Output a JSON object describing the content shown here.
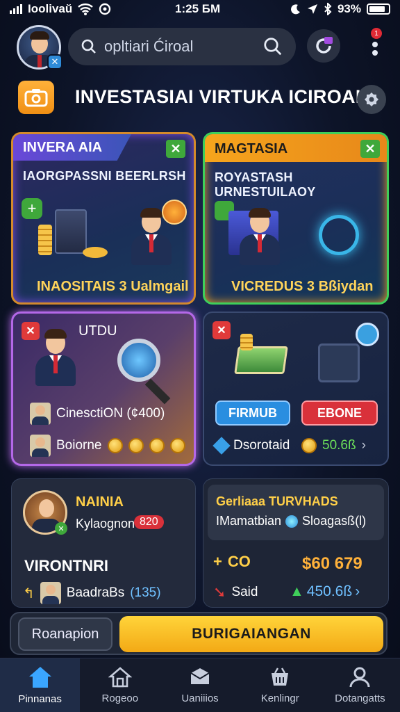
{
  "status": {
    "carrier": "Ioolivaŭ",
    "time": "1:25 ƂM",
    "battery": "93%"
  },
  "search": {
    "placeholder": "opltiari Ćiroal"
  },
  "notification": {
    "count": "1"
  },
  "page_title": "INVESTASIAI VIRTUKA ICIROAL",
  "colors": {
    "accent_yellow": "#f3b21c",
    "accent_green": "#3fa83b",
    "accent_red": "#e03a3a",
    "accent_blue": "#2e8bd8"
  },
  "cards": {
    "c1": {
      "title": "INVERA AIA",
      "subtitle": "IAORGPASSNI BEERLRSH",
      "footer": "INAOSITAIS 3 Ualmgail"
    },
    "c2": {
      "title": "MAGTASIA",
      "subtitle": "ROYASTASH URNESTUILAOY",
      "footer": "VICREDUS 3 Bßiydan"
    },
    "c3": {
      "title": "UTDU",
      "row1": "CinesctiON (¢400)",
      "row2": "Boiorne"
    },
    "c4": {
      "btn_left": "FIRMUB",
      "btn_right": "EBONE",
      "label": "Dsorotaid",
      "value": "50.6ß"
    },
    "c5": {
      "title": "NAINIA",
      "subtitle": "Kylaognon",
      "badge": "820",
      "heading": "VIRONTNRI",
      "row": "BaadraBs",
      "row_value": "(135)"
    },
    "c6": {
      "title": "Gerliaaa TURVHADS",
      "subtitle": "IMamatbian",
      "subtitle2": "Sloagasß(l)",
      "l1": "CO",
      "v1": "$60 679",
      "l2": "Said",
      "v2": "450.6ß"
    }
  },
  "actions": {
    "secondary": "Roanapion",
    "primary": "BURIGAIANGAN"
  },
  "tabs": [
    {
      "label": "Pinnanas",
      "icon": "home-icon"
    },
    {
      "label": "Rogeoo",
      "icon": "house-outline-icon"
    },
    {
      "label": "Uaniiios",
      "icon": "inbox-icon"
    },
    {
      "label": "Kenlingr",
      "icon": "basket-icon"
    },
    {
      "label": "Dotangatts",
      "icon": "user-icon"
    }
  ]
}
